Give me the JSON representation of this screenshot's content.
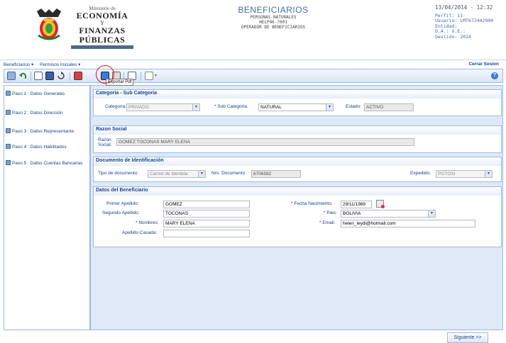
{
  "header": {
    "ministry_small": "Ministerio de",
    "ministry_line1": "ECONOMÍA",
    "ministry_y": "Y",
    "ministry_line2": "FINANZAS PÚBLICAS",
    "title": "BENEFICIARIOS",
    "subtitle1": "PERSONAS NATURALES",
    "subtitle2": "HELP46-7001",
    "subtitle3": "OPERADOR DE BENEFICIARIOS",
    "datetime": "13/04/2014 - 12:32",
    "perfil": "Perfil: 11",
    "usuario": "Usuario: LMT672442900",
    "entidad": "Entidad:",
    "da": "D.A.:   U.E.:",
    "gestion": "Gestión: 2014"
  },
  "menu": {
    "beneficiarios": "Beneficiarios ▾",
    "permisos": "Permisos Iniciales ▾",
    "logout": "Cerrar Sesion"
  },
  "toolbar": {
    "tooltip": "Exportar Pdf",
    "help": "?"
  },
  "nav": [
    {
      "label": "Paso 1 : Datos Generales"
    },
    {
      "label": "Paso 2 : Datos Dirección"
    },
    {
      "label": "Paso 3 : Datos Representante"
    },
    {
      "label": "Paso 4 : Datos Habilitados"
    },
    {
      "label": "Paso 5 : Datos Cuentas Bancarias"
    }
  ],
  "categoria": {
    "title": "Categoria - Sub Categoria",
    "cat_label": "Categoria:",
    "cat_value": "PRIVADO",
    "sub_label": "* Sub Categoria:",
    "sub_value": "NATURAL",
    "estado_label": "Estado:",
    "estado_value": "ACTIVO"
  },
  "razon": {
    "title": "Razon Social",
    "label1": "Razon",
    "label2": "Social:",
    "value": "GOMEZ TOCONAS MARY ELENA"
  },
  "documento": {
    "title": "Documento de Identificación",
    "tipo_label": "Tipo de documento:",
    "tipo_value": "Carnet de Identida",
    "nro_label": "Nro. Documento",
    "nro_value": "6706582",
    "exp_label": "Expedido:",
    "exp_value": "POTOSI"
  },
  "beneficiario": {
    "title": "Datos del Beneficiario",
    "ap1_label": "Primer Apellido:",
    "ap1_value": "GOMEZ",
    "ap2_label": "Segundo Apellido:",
    "ap2_value": "TOCONAS",
    "nom_label": "* Nombres:",
    "nom_value": "MARY ELENA",
    "cas_label": "Apellido Casada:",
    "cas_value": "",
    "fnac_label": "* Fecha Nacimiento:",
    "fnac_value": "29/11/1989",
    "pais_label": "* Pais:",
    "pais_value": "BOLIVIA",
    "email_label": "* Email:",
    "email_value": "helen_leydi@hotmail.com"
  },
  "footer": {
    "next": "Siguiente >>"
  }
}
